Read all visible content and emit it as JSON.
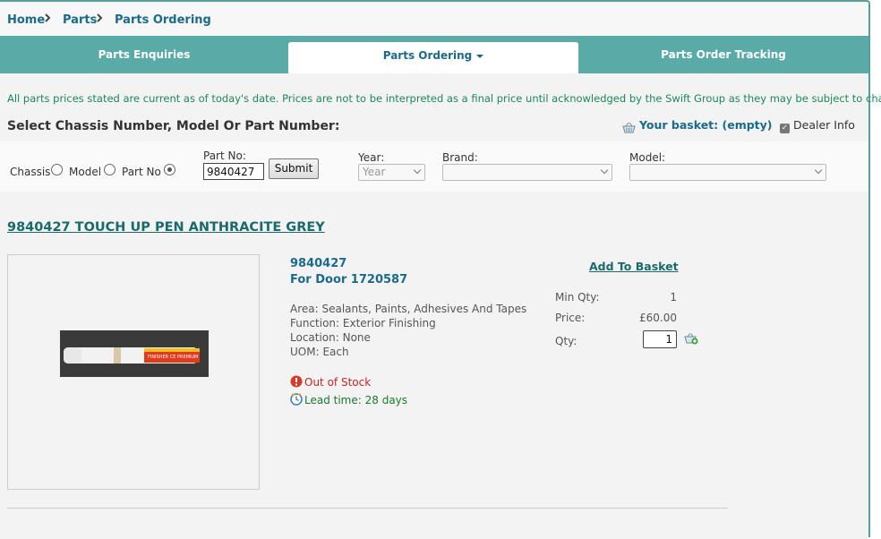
{
  "breadcrumb": {
    "home": "Home",
    "parts": "Parts",
    "current": "Parts Ordering"
  },
  "tabs": [
    {
      "label": "Parts Enquiries"
    },
    {
      "label": "Parts Ordering"
    },
    {
      "label": "Parts Order Tracking"
    }
  ],
  "notice": "All parts prices stated are current as of today's date. Prices are not to be interpreted as a final price until acknowledged by the Swift Group as they may be subject to change.",
  "select_title": "Select Chassis Number, Model Or Part Number:",
  "basket_label": "Your basket: (empty)",
  "dealer_info_label": "Dealer Info",
  "search": {
    "chassis_label": "Chassis",
    "model_label": "Model",
    "partno_radio_label": "Part No",
    "selected": "Part No",
    "partno_field_label": "Part No:",
    "partno_value": "9840427",
    "submit_label": "Submit",
    "year_label": "Year:",
    "year_value": "Year",
    "brand_label": "Brand:",
    "brand_value": "",
    "model_select_label": "Model:",
    "model_value": ""
  },
  "product": {
    "title": "9840427 TOUCH UP PEN ANTHRACITE GREY",
    "part_number": "9840427",
    "for_door": "For Door 1720587",
    "area": "Area: Sealants, Paints, Adhesives And Tapes",
    "function": "Function: Exterior Finishing",
    "location": "Location: None",
    "uom": "UOM: Each",
    "stock_status": "Out of Stock",
    "lead_time": "Lead time: 28 days",
    "add_to_basket": "Add To Basket",
    "min_qty_label": "Min Qty:",
    "min_qty": "1",
    "price_label": "Price:",
    "price": "£60.00",
    "qty_label": "Qty:",
    "qty": "1",
    "pen_brand_text": "FINISHER CE PREMIUM"
  },
  "colors": {
    "accent_teal": "#5aaaa8",
    "link_blue": "#1a6a8c",
    "notice_green": "#1a8a5a",
    "out_of_stock_red": "#cc2222",
    "lead_time_green": "#1a7a2a"
  },
  "icons": [
    "chevron-right-icon",
    "caret-down-icon",
    "basket-icon",
    "checkbox-icon",
    "error-icon",
    "clock-icon",
    "add-basket-icon"
  ]
}
